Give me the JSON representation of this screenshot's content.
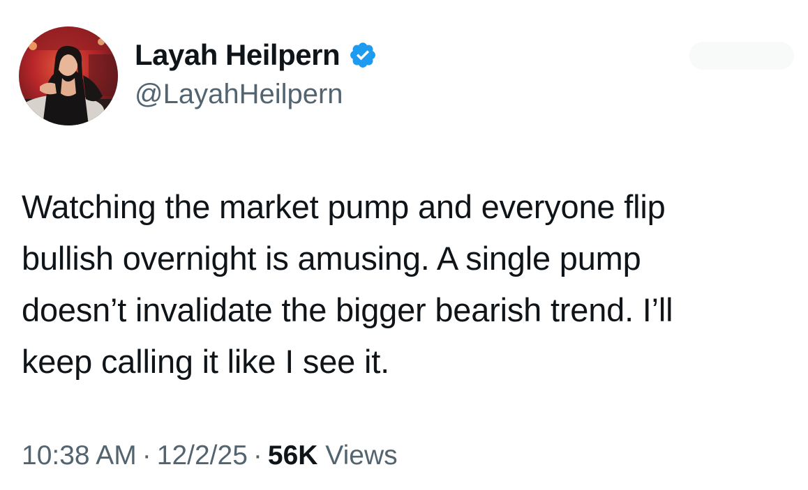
{
  "author": {
    "display_name": "Layah Heilpern",
    "handle": "@LayahHeilpern",
    "verified": true,
    "verified_color": "#1d9bf0"
  },
  "tweet": {
    "text": "Watching the market pump and everyone flip bullish overnight is amusing. A single pump doesn’t invalidate the bigger bearish trend. I’ll keep calling it like I see it.",
    "lines": [
      "Watching the market pump and everyone flip",
      "bullish overnight is amusing. A single pump",
      "doesn’t invalidate the bigger bearish trend. I’ll",
      "keep calling it like I see it."
    ]
  },
  "meta": {
    "time": "10:38 AM",
    "separator": "·",
    "date": "12/2/25",
    "views_count": "56K",
    "views_label": "Views"
  },
  "icons": {
    "verified": "verified-badge-icon",
    "avatar": "profile-photo"
  },
  "colors": {
    "text_primary": "#0f1419",
    "text_secondary": "#536471",
    "background": "#ffffff"
  }
}
